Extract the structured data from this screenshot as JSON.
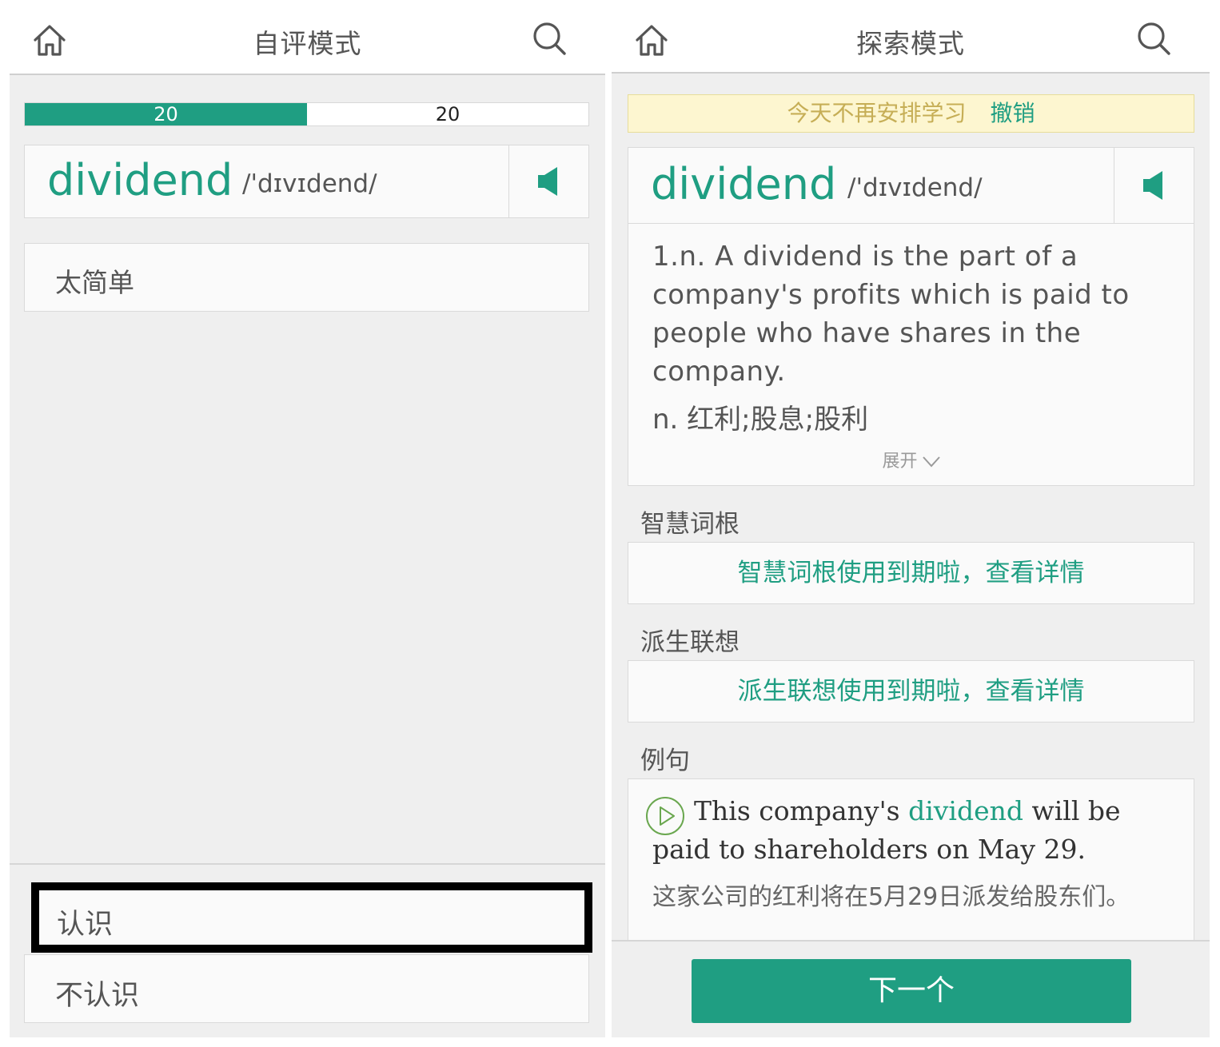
{
  "left": {
    "title": "自评模式",
    "progress": {
      "left_count": "20",
      "right_count": "20",
      "fraction": 0.5
    },
    "word": "dividend",
    "phonetic": "/'dɪvɪdend/",
    "easy_label": "太简单",
    "know_label": "认识",
    "not_know_label": "不认识"
  },
  "right": {
    "title": "探索模式",
    "banner": {
      "text": "今天不再安排学习",
      "undo": "撤销"
    },
    "word": "dividend",
    "phonetic": "/'dɪvɪdend/",
    "definition_en": "1.n. A dividend is the part of a company's profits which is paid to people who have shares in the company.",
    "definition_cn": "n. 红利;股息;股利",
    "expand_label": "展开",
    "roots": {
      "label": "智慧词根",
      "link": "智慧词根使用到期啦，查看详情"
    },
    "derive": {
      "label": "派生联想",
      "link": "派生联想使用到期啦，查看详情"
    },
    "example": {
      "label": "例句",
      "en_before": "This company's ",
      "en_highlight": "dividend",
      "en_after": " will be paid to shareholders on May 29.",
      "cn": "这家公司的红利将在5月29日派发给股东们。"
    },
    "next_label": "下一个"
  },
  "colors": {
    "accent": "#1f9e82",
    "banner_bg": "#fdf6d0",
    "banner_text": "#c6ae56"
  },
  "icons": [
    "home-icon",
    "search-icon",
    "speaker-icon",
    "chevron-down-icon",
    "play-icon"
  ]
}
